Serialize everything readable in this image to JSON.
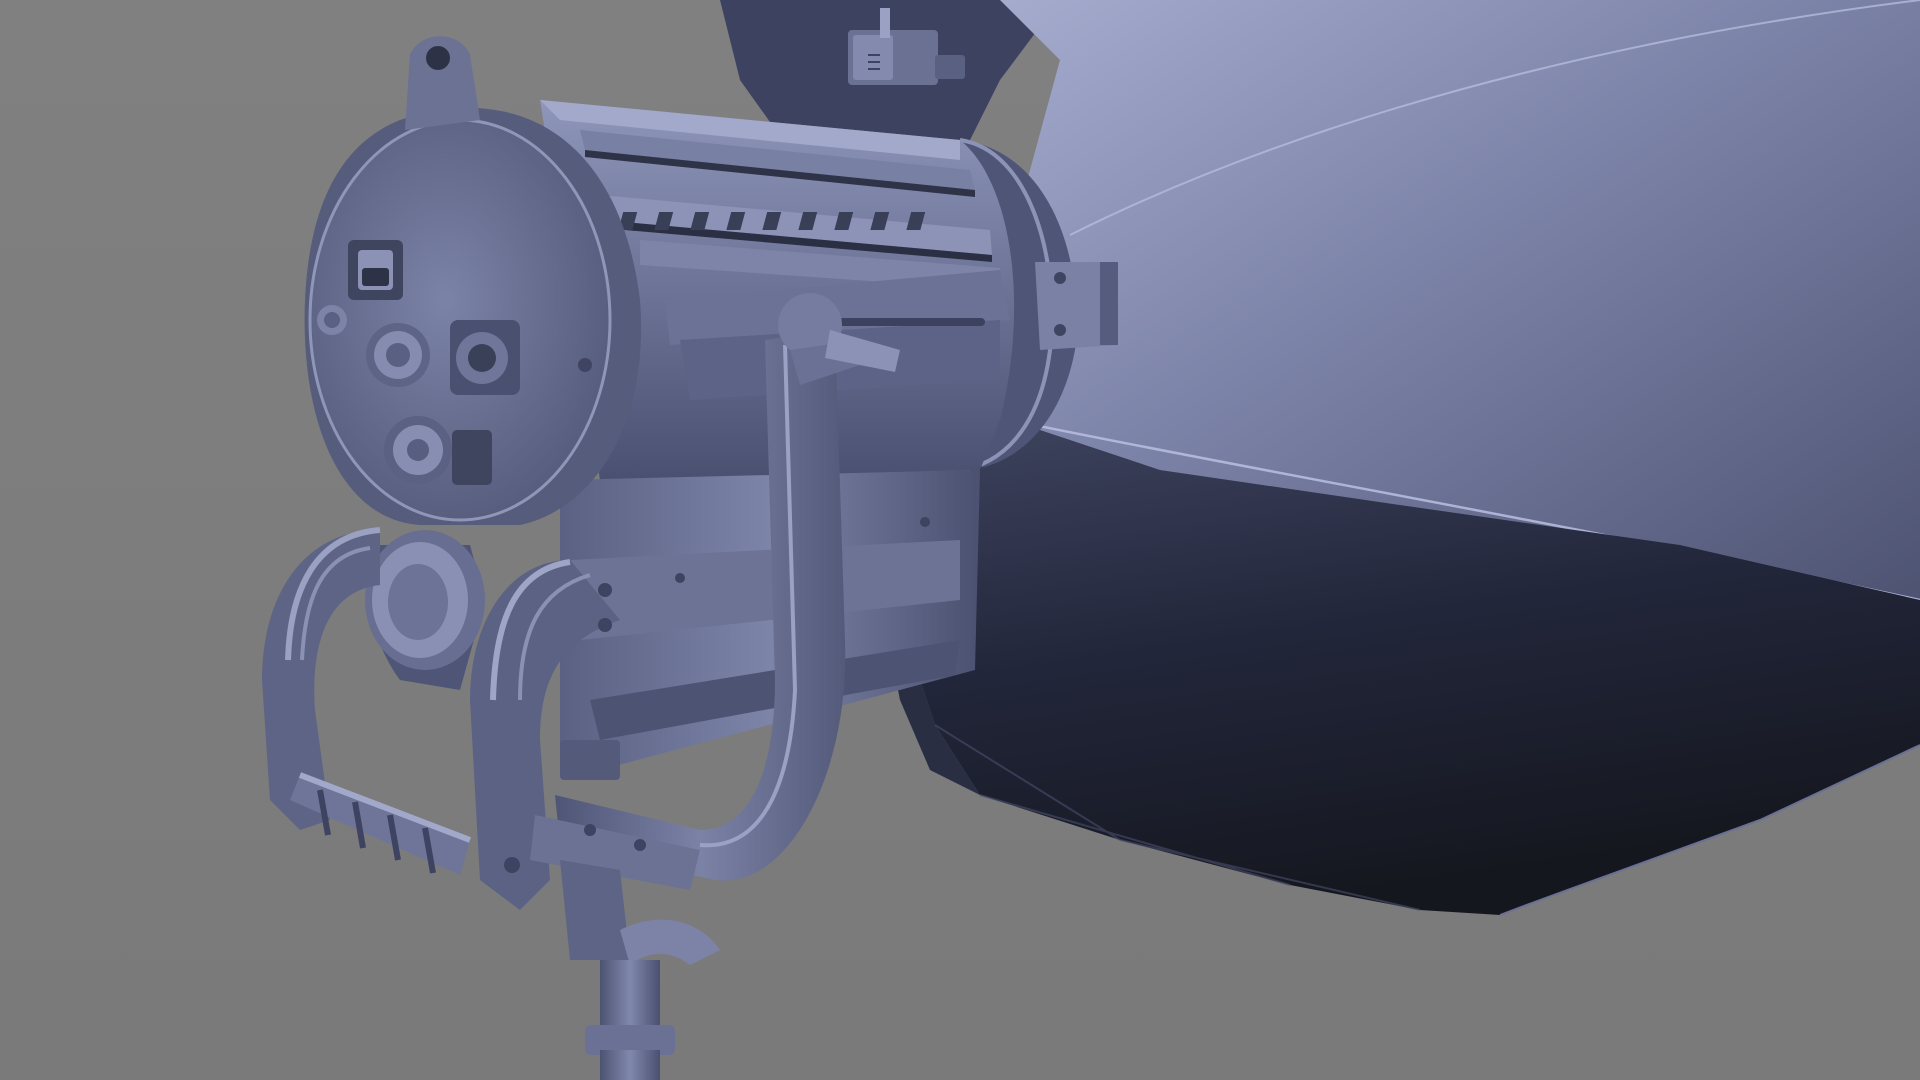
{
  "scene": {
    "subject": "studio-light-with-softbox",
    "colors": {
      "background": "#7d7d7d",
      "metal_base": "#6e7596",
      "metal_light": "#9aa2c4",
      "metal_mid": "#5d6484",
      "metal_dark": "#3b4059",
      "metal_shadow": "#262a3b",
      "softbox_outer_light": "#8c93b6",
      "softbox_outer_mid": "#6a7094",
      "softbox_inner_dark": "#1d2030",
      "softbox_inner_mid": "#3a3f56"
    }
  }
}
